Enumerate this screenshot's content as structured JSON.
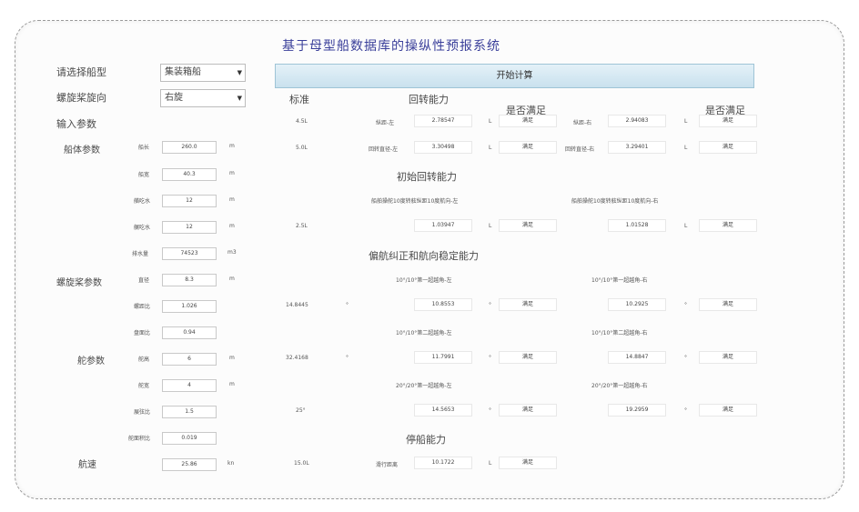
{
  "title": "基于母型船数据库的操纵性预报系统",
  "controls": {
    "ship_type_label": "请选择船型",
    "ship_type_value": "集装箱船",
    "prop_dir_label": "螺旋桨旋向",
    "prop_dir_value": "右旋",
    "input_params_label": "输入参数",
    "start_button": "开始计算"
  },
  "groups": {
    "hull": "船体参数",
    "propeller": "螺旋桨参数",
    "rudder": "舵参数",
    "speed": "航速"
  },
  "params": [
    {
      "label": "船长",
      "value": "260.0",
      "unit": "m"
    },
    {
      "label": "船宽",
      "value": "40.3",
      "unit": "m"
    },
    {
      "label": "艏吃水",
      "value": "12",
      "unit": "m"
    },
    {
      "label": "艉吃水",
      "value": "12",
      "unit": "m"
    },
    {
      "label": "排水量",
      "value": "74523",
      "unit": "m3"
    },
    {
      "label": "直径",
      "value": "8.3",
      "unit": "m"
    },
    {
      "label": "螺距比",
      "value": "1.026",
      "unit": ""
    },
    {
      "label": "盘面比",
      "value": "0.94",
      "unit": ""
    },
    {
      "label": "舵高",
      "value": "6",
      "unit": "m"
    },
    {
      "label": "舵宽",
      "value": "4",
      "unit": "m"
    },
    {
      "label": "展弦比",
      "value": "1.5",
      "unit": ""
    },
    {
      "label": "舵面积比",
      "value": "0.019",
      "unit": ""
    },
    {
      "label": "",
      "value": "25.86",
      "unit": "kn"
    }
  ],
  "headers": {
    "standard": "标准",
    "satisfied_1": "是否满足",
    "satisfied_2": "是否满足"
  },
  "sections": {
    "turning": "回转能力",
    "initial_turning": "初始回转能力",
    "yaw_checking": "偏航纠正和航向稳定能力",
    "stopping": "停船能力"
  },
  "turning_rows": [
    {
      "std": "4.5L",
      "l_label": "纵距-左",
      "l_val": "2.78547",
      "l_unit": "L",
      "l_ok": "满足",
      "r_label": "纵距-右",
      "r_val": "2.94083",
      "r_unit": "L",
      "r_ok": "满足"
    },
    {
      "std": "5.0L",
      "l_label": "回转直径-左",
      "l_val": "3.30498",
      "l_unit": "L",
      "l_ok": "满足",
      "r_label": "回转直径-右",
      "r_val": "3.29401",
      "r_unit": "L",
      "r_ok": "满足"
    }
  ],
  "initial_turning": {
    "l_label": "船舶操舵10度转舷纵距10度航向-左",
    "r_label": "船舶操舵10度转舷纵距10度航向-右",
    "std": "2.5L",
    "l_val": "1.03947",
    "l_unit": "L",
    "l_ok": "满足",
    "r_val": "1.01528",
    "r_unit": "L",
    "r_ok": "满足"
  },
  "zigzag": [
    {
      "l_label": "10°/10°第一超越角-左",
      "r_label": "10°/10°第一超越角-右",
      "std": "14.8445",
      "std_unit": "°",
      "l_val": "10.8553",
      "l_unit": "°",
      "l_ok": "满足",
      "r_val": "10.2925",
      "r_unit": "°",
      "r_ok": "满足"
    },
    {
      "l_label": "10°/10°第二超越角-左",
      "r_label": "10°/10°第二超越角-右",
      "std": "32.4168",
      "std_unit": "°",
      "l_val": "11.7991",
      "l_unit": "°",
      "l_ok": "满足",
      "r_val": "14.8847",
      "r_unit": "°",
      "r_ok": "满足"
    },
    {
      "l_label": "20°/20°第一超越角-左",
      "r_label": "20°/20°第一超越角-右",
      "std": "25°",
      "std_unit": "",
      "l_val": "14.5653",
      "l_unit": "°",
      "l_ok": "满足",
      "r_val": "19.2959",
      "r_unit": "°",
      "r_ok": "满足"
    }
  ],
  "stopping": {
    "std": "15.0L",
    "label": "滑行距离",
    "value": "10.1722",
    "unit": "L",
    "ok": "满足"
  }
}
